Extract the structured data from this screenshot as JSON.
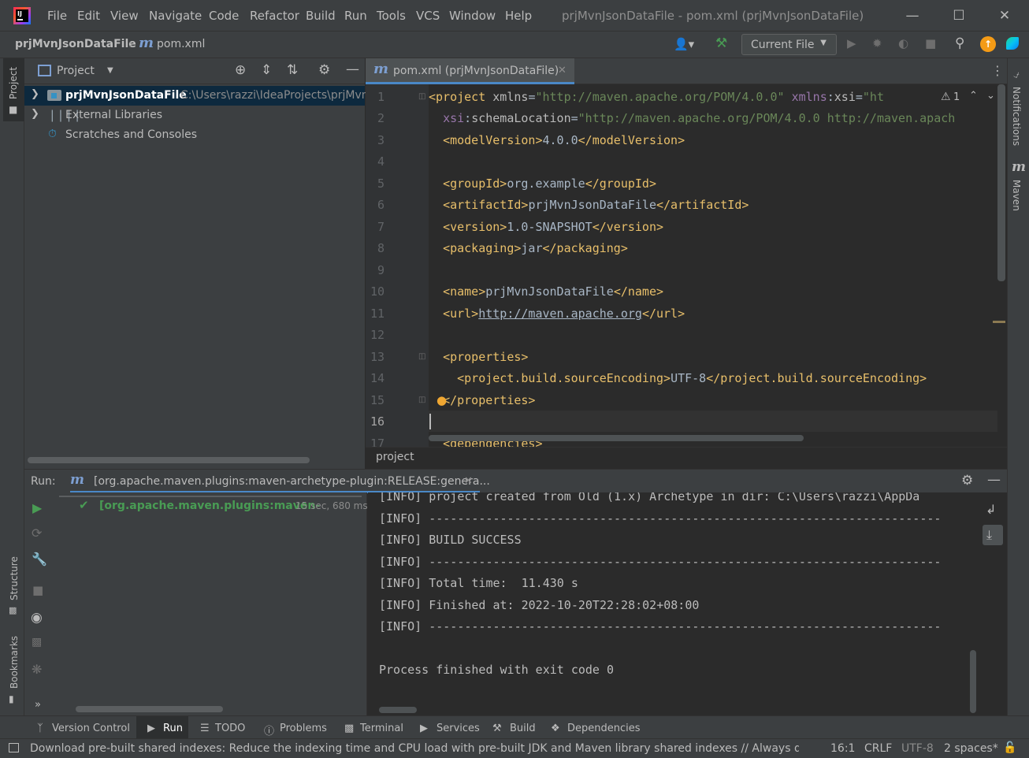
{
  "title_bar": {
    "menus": [
      "File",
      "Edit",
      "View",
      "Navigate",
      "Code",
      "Refactor",
      "Build",
      "Run",
      "Tools",
      "VCS",
      "Window",
      "Help"
    ],
    "window_title": "prjMvnJsonDataFile - pom.xml (prjMvnJsonDataFile)"
  },
  "nav_bar": {
    "breadcrumb_project": "prjMvnJsonDataFile",
    "breadcrumb_file": "pom.xml",
    "run_config": "Current File"
  },
  "project_panel": {
    "title": "Project",
    "tree": [
      {
        "label": "prjMvnJsonDataFile",
        "path": "C:\\Users\\razzi\\IdeaProjects\\prjMvnJ"
      },
      {
        "label": "External Libraries"
      },
      {
        "label": "Scratches and Consoles"
      }
    ]
  },
  "left_stripe": {
    "project": "Project",
    "structure": "Structure",
    "bookmarks": "Bookmarks"
  },
  "right_stripe": {
    "notifications": "Notifications",
    "maven": "Maven"
  },
  "editor": {
    "tab_label": "pom.xml (prjMvnJsonDataFile)",
    "warning_count": "1",
    "breadcrumb": "project",
    "current_line": 16,
    "lines": [
      "1",
      "2",
      "3",
      "4",
      "5",
      "6",
      "7",
      "8",
      "9",
      "10",
      "11",
      "12",
      "13",
      "14",
      "15",
      "16",
      "17"
    ]
  },
  "run_panel": {
    "label": "Run:",
    "tab_label": "[org.apache.maven.plugins:maven-archetype-plugin:RELEASE:genera...",
    "tree_item": "[org.apache.maven.plugins:maven-",
    "tree_time": "15 sec, 680 ms",
    "console": [
      "[INFO] project created from Old (1.x) Archetype in dir: C:\\Users\\razzi\\AppDa",
      "[INFO] ------------------------------------------------------------------------",
      "[INFO] BUILD SUCCESS",
      "[INFO] ------------------------------------------------------------------------",
      "[INFO] Total time:  11.430 s",
      "[INFO] Finished at: 2022-10-20T22:28:02+08:00",
      "[INFO] ------------------------------------------------------------------------",
      "",
      "Process finished with exit code 0"
    ]
  },
  "bottom_tools": [
    "Version Control",
    "Run",
    "TODO",
    "Problems",
    "Terminal",
    "Services",
    "Build",
    "Dependencies"
  ],
  "status_bar": {
    "message": "Download pre-built shared indexes: Reduce the indexing time and CPU load with pre-built JDK and Maven library shared indexes // Always downloa",
    "position": "16:1",
    "line_sep": "CRLF",
    "encoding": "UTF-8",
    "indent": "2 spaces*"
  },
  "colors": {
    "accent": "#4a88c7",
    "success": "#499c54",
    "xml_tag": "#e8bf6a",
    "xml_string": "#6a8759"
  }
}
